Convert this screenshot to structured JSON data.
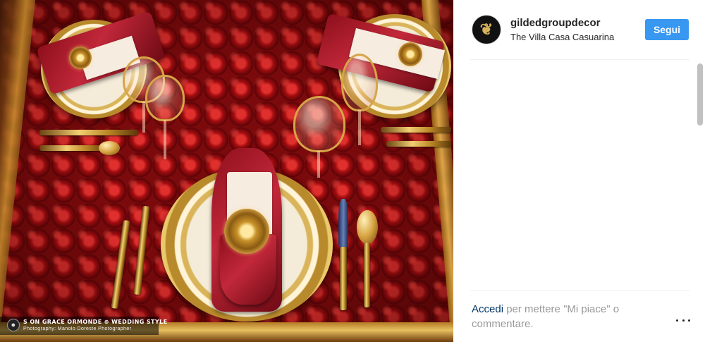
{
  "post": {
    "photo_credit": {
      "line1": "S    ON GRACE ORMONDE  ⊕  WEDDING STYLE",
      "line2": "Photography: Manolo Doreste Photographer"
    }
  },
  "header": {
    "username": "gildedgroupdecor",
    "location": "The Villa Casa Casuarina",
    "follow_label": "Segui",
    "avatar_icon": "gilded-monogram-icon"
  },
  "footer": {
    "login_link": "Accedi",
    "login_text": " per mettere \"Mi piace\" o commentare.",
    "more_icon": "more-options-icon"
  },
  "colors": {
    "follow_button": "#3897f0",
    "link": "#003569",
    "muted_text": "#999999"
  }
}
